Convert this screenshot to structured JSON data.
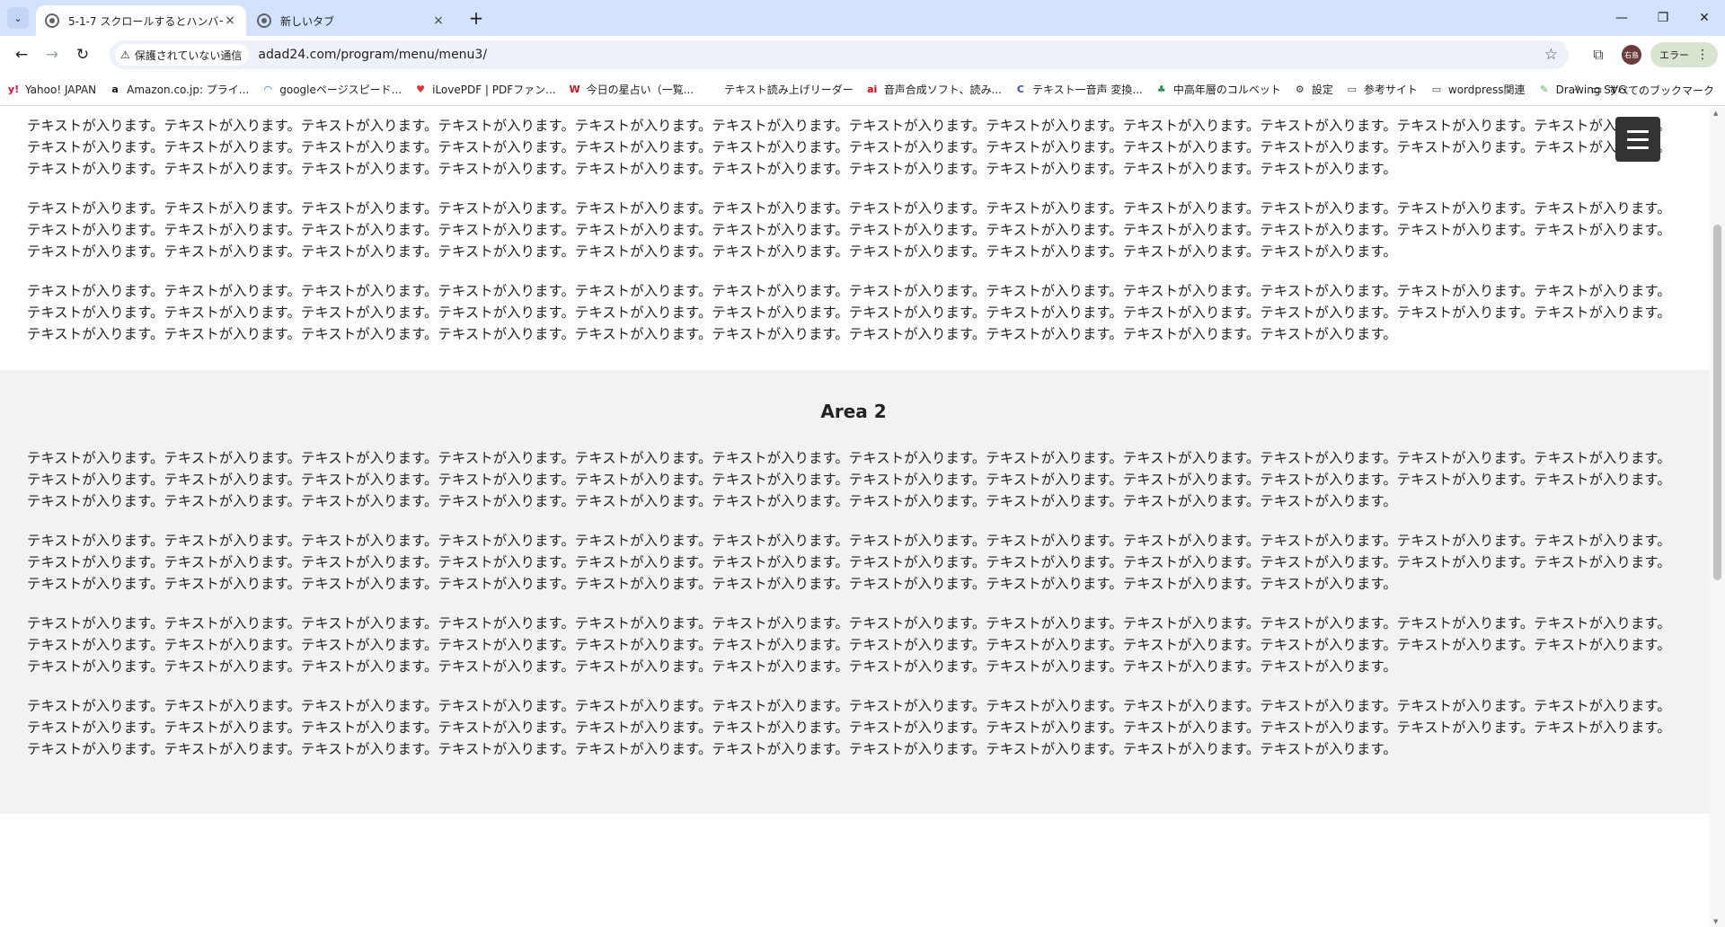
{
  "browser": {
    "active_tab_title": "5-1-7 スクロールするとハンバーガーメ",
    "inactive_tab_title": "新しいタブ",
    "tab_close": "×",
    "new_tab": "+",
    "win_minimize": "—",
    "win_restore": "❐",
    "win_close": "✕",
    "security_label": "保護されていない通信",
    "url": "adad24.com/program/menu/menu3/",
    "profile_initials": "右島",
    "error_label": "エラー"
  },
  "bookmarks": [
    {
      "label": "Yahoo! JAPAN",
      "icon": "y!",
      "color": "#ff0033"
    },
    {
      "label": "Amazon.co.jp: プライ...",
      "icon": "a",
      "color": "#111111"
    },
    {
      "label": "googleページスピード...",
      "icon": "◠",
      "color": "#1a73e8"
    },
    {
      "label": "iLovePDF | PDFファン...",
      "icon": "♥",
      "color": "#e5322d"
    },
    {
      "label": "今日の星占い（一覧...",
      "icon": "W",
      "color": "#c4161c"
    },
    {
      "label": "テキスト読み上げリーダー",
      "icon": "",
      "color": "#999999"
    },
    {
      "label": "音声合成ソフト、読み...",
      "icon": "ai",
      "color": "#e60012"
    },
    {
      "label": "テキスト一音声 変換...",
      "icon": "C",
      "color": "#3c4fb4"
    },
    {
      "label": "中高年層のコルベット",
      "icon": "♣",
      "color": "#2e8b57"
    },
    {
      "label": "設定",
      "icon": "⚙",
      "color": "#333333"
    },
    {
      "label": "参考サイト",
      "icon": "▭",
      "color": "#444444"
    },
    {
      "label": "wordpress関連",
      "icon": "▭",
      "color": "#444444"
    },
    {
      "label": "Drawing SVG",
      "icon": "✎",
      "color": "#4caf50"
    }
  ],
  "bookmarks_more": "»",
  "all_bookmarks_label": "すべてのブックマーク",
  "page": {
    "area1_paragraphs": [
      "テキストが入ります。テキストが入ります。テキストが入ります。テキストが入ります。テキストが入ります。テキストが入ります。テキストが入ります。テキストが入ります。テキストが入ります。テキストが入ります。テキストが入ります。テキストが入ります。テキストが入ります。テキストが入ります。テキストが入ります。テキストが入ります。テキストが入ります。テキストが入ります。テキストが入ります。テキストが入ります。テキストが入ります。テキストが入ります。テキストが入ります。テキストが入ります。テキストが入ります。テキストが入ります。テキストが入ります。テキストが入ります。テキストが入ります。テキストが入ります。テキストが入ります。テキストが入ります。テキストが入ります。テキストが入ります。",
      "テキストが入ります。テキストが入ります。テキストが入ります。テキストが入ります。テキストが入ります。テキストが入ります。テキストが入ります。テキストが入ります。テキストが入ります。テキストが入ります。テキストが入ります。テキストが入ります。テキストが入ります。テキストが入ります。テキストが入ります。テキストが入ります。テキストが入ります。テキストが入ります。テキストが入ります。テキストが入ります。テキストが入ります。テキストが入ります。テキストが入ります。テキストが入ります。テキストが入ります。テキストが入ります。テキストが入ります。テキストが入ります。テキストが入ります。テキストが入ります。テキストが入ります。テキストが入ります。テキストが入ります。テキストが入ります。",
      "テキストが入ります。テキストが入ります。テキストが入ります。テキストが入ります。テキストが入ります。テキストが入ります。テキストが入ります。テキストが入ります。テキストが入ります。テキストが入ります。テキストが入ります。テキストが入ります。テキストが入ります。テキストが入ります。テキストが入ります。テキストが入ります。テキストが入ります。テキストが入ります。テキストが入ります。テキストが入ります。テキストが入ります。テキストが入ります。テキストが入ります。テキストが入ります。テキストが入ります。テキストが入ります。テキストが入ります。テキストが入ります。テキストが入ります。テキストが入ります。テキストが入ります。テキストが入ります。テキストが入ります。テキストが入ります。"
    ],
    "area2_title": "Area 2",
    "area2_paragraphs": [
      "テキストが入ります。テキストが入ります。テキストが入ります。テキストが入ります。テキストが入ります。テキストが入ります。テキストが入ります。テキストが入ります。テキストが入ります。テキストが入ります。テキストが入ります。テキストが入ります。テキストが入ります。テキストが入ります。テキストが入ります。テキストが入ります。テキストが入ります。テキストが入ります。テキストが入ります。テキストが入ります。テキストが入ります。テキストが入ります。テキストが入ります。テキストが入ります。テキストが入ります。テキストが入ります。テキストが入ります。テキストが入ります。テキストが入ります。テキストが入ります。テキストが入ります。テキストが入ります。テキストが入ります。テキストが入ります。",
      "テキストが入ります。テキストが入ります。テキストが入ります。テキストが入ります。テキストが入ります。テキストが入ります。テキストが入ります。テキストが入ります。テキストが入ります。テキストが入ります。テキストが入ります。テキストが入ります。テキストが入ります。テキストが入ります。テキストが入ります。テキストが入ります。テキストが入ります。テキストが入ります。テキストが入ります。テキストが入ります。テキストが入ります。テキストが入ります。テキストが入ります。テキストが入ります。テキストが入ります。テキストが入ります。テキストが入ります。テキストが入ります。テキストが入ります。テキストが入ります。テキストが入ります。テキストが入ります。テキストが入ります。テキストが入ります。",
      "テキストが入ります。テキストが入ります。テキストが入ります。テキストが入ります。テキストが入ります。テキストが入ります。テキストが入ります。テキストが入ります。テキストが入ります。テキストが入ります。テキストが入ります。テキストが入ります。テキストが入ります。テキストが入ります。テキストが入ります。テキストが入ります。テキストが入ります。テキストが入ります。テキストが入ります。テキストが入ります。テキストが入ります。テキストが入ります。テキストが入ります。テキストが入ります。テキストが入ります。テキストが入ります。テキストが入ります。テキストが入ります。テキストが入ります。テキストが入ります。テキストが入ります。テキストが入ります。テキストが入ります。テキストが入ります。",
      "テキストが入ります。テキストが入ります。テキストが入ります。テキストが入ります。テキストが入ります。テキストが入ります。テキストが入ります。テキストが入ります。テキストが入ります。テキストが入ります。テキストが入ります。テキストが入ります。テキストが入ります。テキストが入ります。テキストが入ります。テキストが入ります。テキストが入ります。テキストが入ります。テキストが入ります。テキストが入ります。テキストが入ります。テキストが入ります。テキストが入ります。テキストが入ります。テキストが入ります。テキストが入ります。テキストが入ります。テキストが入ります。テキストが入ります。テキストが入ります。テキストが入ります。テキストが入ります。テキストが入ります。テキストが入ります。"
    ]
  },
  "colors": {
    "tabstrip_bg": "#d3e3fd",
    "area2_bg": "#f2f2f2",
    "hamburger_bg": "#333333"
  }
}
